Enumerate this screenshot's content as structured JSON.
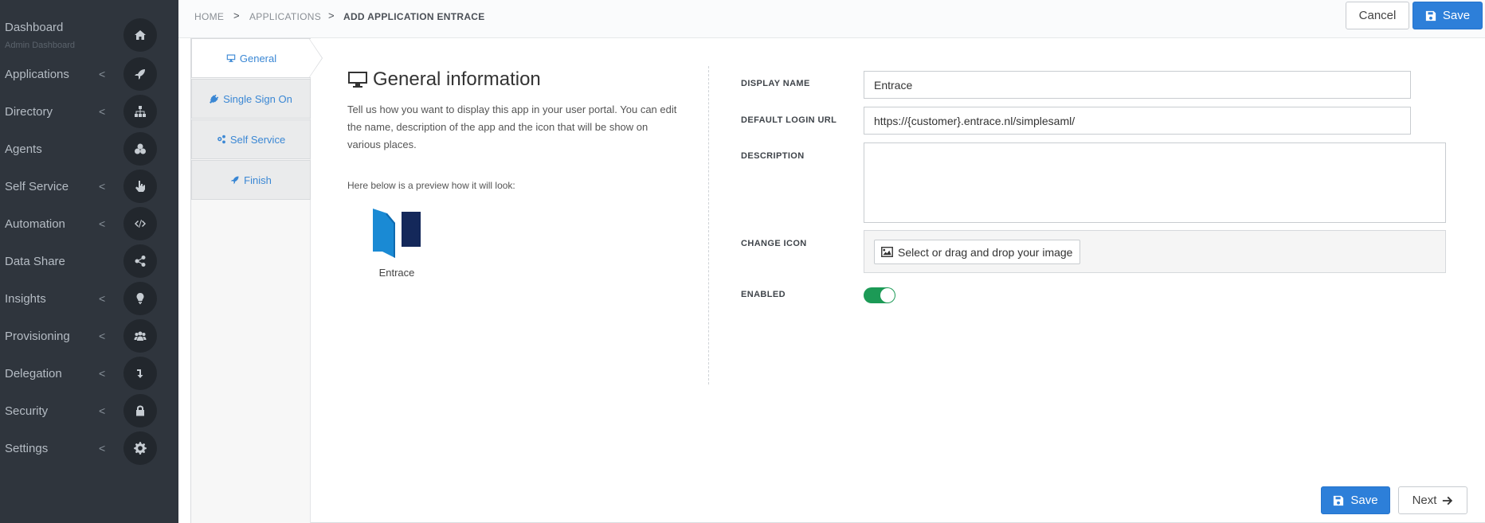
{
  "sidebar": {
    "items": [
      {
        "label": "Dashboard",
        "sub": "Admin Dashboard",
        "chevron": false,
        "icon": "home-icon"
      },
      {
        "label": "Applications",
        "chevron": true,
        "icon": "rocket-icon"
      },
      {
        "label": "Directory",
        "chevron": true,
        "icon": "sitemap-icon"
      },
      {
        "label": "Agents",
        "chevron": false,
        "icon": "agents-icon"
      },
      {
        "label": "Self Service",
        "chevron": true,
        "icon": "hand-pointer-icon"
      },
      {
        "label": "Automation",
        "chevron": true,
        "icon": "code-icon"
      },
      {
        "label": "Data Share",
        "chevron": false,
        "icon": "share-icon"
      },
      {
        "label": "Insights",
        "chevron": true,
        "icon": "lightbulb-icon"
      },
      {
        "label": "Provisioning",
        "chevron": true,
        "icon": "users-icon"
      },
      {
        "label": "Delegation",
        "chevron": true,
        "icon": "level-down-icon"
      },
      {
        "label": "Security",
        "chevron": true,
        "icon": "lock-icon"
      },
      {
        "label": "Settings",
        "chevron": true,
        "icon": "gear-icon"
      }
    ],
    "chevron_glyph": "<"
  },
  "breadcrumb": {
    "home": "HOME",
    "applications": "APPLICATIONS",
    "current": "ADD APPLICATION ENTRACE",
    "separator": ">"
  },
  "toolbar": {
    "cancel_label": "Cancel",
    "save_label": "Save"
  },
  "wizard": {
    "steps": [
      {
        "label": "General",
        "icon": "monitor-icon"
      },
      {
        "label": "Single Sign On",
        "icon": "plug-icon"
      },
      {
        "label": "Self Service",
        "icon": "cogs-icon"
      },
      {
        "label": "Finish",
        "icon": "rocket-icon"
      }
    ],
    "active_step": 0
  },
  "general": {
    "title": "General information",
    "intro": "Tell us how you want to display this app in your user portal. You can edit the name, description of the app and the icon that will be show on various places.",
    "preview_label": "Here below is a preview how it will look:",
    "app_name": "Entrace"
  },
  "form": {
    "display_name_label": "DISPLAY NAME",
    "display_name_value": "Entrace",
    "login_url_label": "DEFAULT LOGIN URL",
    "login_url_value": "https://{customer}.entrace.nl/simplesaml/",
    "description_label": "DESCRIPTION",
    "description_value": "",
    "change_icon_label": "CHANGE ICON",
    "change_icon_button": "Select or drag and drop your image",
    "enabled_label": "ENABLED",
    "enabled": true
  },
  "footer": {
    "save_label": "Save",
    "next_label": "Next"
  },
  "colors": {
    "sidebar_bg": "#2f353d",
    "accent_blue": "#2d7fd9",
    "toggle_on": "#1c9a56",
    "logo_light": "#1a8ad4",
    "logo_dark": "#14285a"
  }
}
